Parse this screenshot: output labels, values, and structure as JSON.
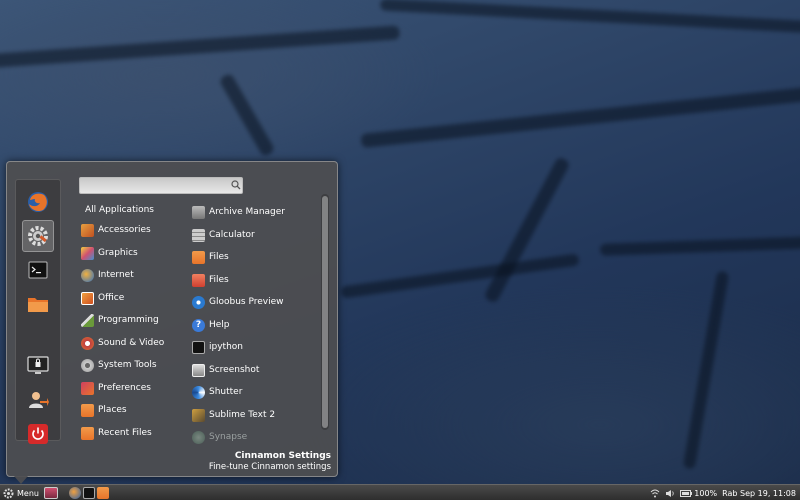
{
  "search": {
    "placeholder": "",
    "value": ""
  },
  "categories": [
    {
      "label": "All Applications",
      "icon": "none"
    },
    {
      "label": "Accessories",
      "icon": "accessories-icon"
    },
    {
      "label": "Graphics",
      "icon": "graphics-icon"
    },
    {
      "label": "Internet",
      "icon": "internet-icon"
    },
    {
      "label": "Office",
      "icon": "office-icon"
    },
    {
      "label": "Programming",
      "icon": "programming-icon"
    },
    {
      "label": "Sound & Video",
      "icon": "sound-video-icon"
    },
    {
      "label": "System Tools",
      "icon": "system-tools-icon"
    },
    {
      "label": "Preferences",
      "icon": "preferences-icon"
    },
    {
      "label": "Places",
      "icon": "places-folder-icon"
    },
    {
      "label": "Recent Files",
      "icon": "recent-files-folder-icon"
    }
  ],
  "apps": [
    {
      "label": "Archive Manager"
    },
    {
      "label": "Calculator"
    },
    {
      "label": "Files"
    },
    {
      "label": "Files"
    },
    {
      "label": "Gloobus Preview"
    },
    {
      "label": "Help"
    },
    {
      "label": "ipython"
    },
    {
      "label": "Screenshot"
    },
    {
      "label": "Shutter"
    },
    {
      "label": "Sublime Text 2"
    },
    {
      "label": "Synapse"
    }
  ],
  "description": {
    "title": "Cinnamon Settings",
    "subtitle": "Fine-tune Cinnamon settings"
  },
  "panel": {
    "menu_label": "Menu",
    "battery": "100%",
    "clock": "Rab Sep 19, 11:08"
  },
  "colors": {
    "accent_orange": "#e8742a",
    "firefox_blue": "#2a5fa8",
    "power_red": "#d62a2a"
  }
}
